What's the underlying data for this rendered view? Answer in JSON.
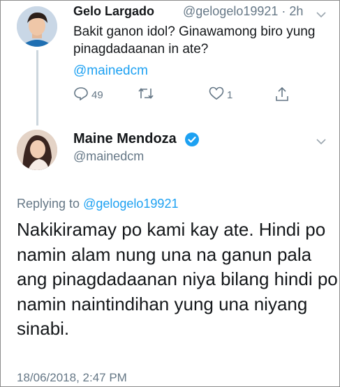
{
  "tweet1": {
    "display_name": "Gelo Largado",
    "handle_time": "@gelogelo19921 · 2h",
    "text": "Bakit ganon idol? Ginawamong  biro yung pinagdadaanan in ate?",
    "mention": "@mainedcm",
    "reply_count": "49",
    "retweet_count": "",
    "like_count": "1"
  },
  "tweet2": {
    "display_name": "Maine Mendoza",
    "handle": "@mainedcm",
    "replying_prefix": "Replying to",
    "replying_to": "@gelogelo19921",
    "text": "Nakikiramay po kami kay ate. Hindi po namin alam nung una na ganun pala ang pinagdadaanan niya bilang hindi po namin naintindihan yung una niyang sinabi.",
    "timestamp": "18/06/2018, 2:47 PM"
  },
  "colors": {
    "accent": "#1da1f2",
    "muted": "#657786",
    "text": "#14171a",
    "thread_line": "#ccd6dd"
  },
  "icons": [
    "reply-icon",
    "retweet-icon",
    "like-icon",
    "share-icon",
    "chevron-down-icon",
    "verified-badge-icon"
  ]
}
